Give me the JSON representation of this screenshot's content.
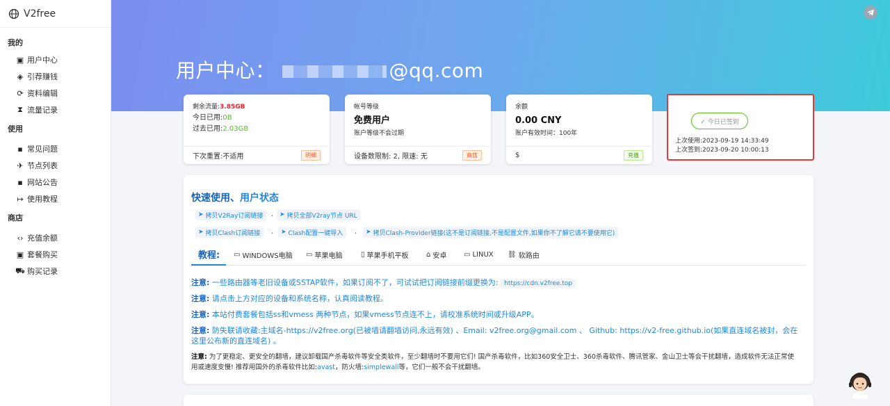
{
  "brand": {
    "name": "V2free",
    "icon": "globe-icon"
  },
  "sidebar": {
    "sections": [
      {
        "title": "我的",
        "items": [
          {
            "label": "用户中心",
            "icon": "wallet-icon"
          },
          {
            "label": "引荐赚钱",
            "icon": "tag-icon"
          },
          {
            "label": "资料编辑",
            "icon": "sync-icon"
          },
          {
            "label": "流量记录",
            "icon": "hourglass-icon"
          }
        ]
      },
      {
        "title": "使用",
        "items": [
          {
            "label": "常见问题",
            "icon": "comment-alert-icon"
          },
          {
            "label": "节点列表",
            "icon": "plane-icon"
          },
          {
            "label": "网站公告",
            "icon": "announcement-icon"
          },
          {
            "label": "使用教程",
            "icon": "login-arrow-icon"
          }
        ]
      },
      {
        "title": "商店",
        "items": [
          {
            "label": "充值余额",
            "icon": "code-icon"
          },
          {
            "label": "套餐购买",
            "icon": "shopping-bag-icon"
          },
          {
            "label": "购买记录",
            "icon": "cart-icon"
          }
        ]
      }
    ]
  },
  "hero": {
    "title_prefix": "用户中心：",
    "email_suffix": "@qq.com"
  },
  "cards": {
    "traffic": {
      "remaining_label": "剩余流量:",
      "remaining_value": "3.85GB",
      "today_label": "今日已用:",
      "today_value": "0B",
      "past_label": "过去已用:",
      "past_value": "2.03GB",
      "reset": "下次重置:不适用",
      "tag": "明细"
    },
    "level": {
      "label": "帐号等级",
      "value": "免费用户",
      "sub": "账户等级不会过期",
      "foot": "设备数限制: 2, 限速: 无",
      "tag": "商店"
    },
    "balance": {
      "label": "余额",
      "value": "0.00 CNY",
      "sub": "账户有效时间：100年",
      "foot": "$",
      "tag": "充值"
    },
    "checkin": {
      "button": "✓ 今日已签到",
      "last_used": "上次使用:2023-09-19 14:33:49",
      "last_checkin": "上次签到:2023-09-20 10:00:13"
    }
  },
  "panel": {
    "title_a": "快速使用、",
    "title_b": "用户状态",
    "chips": [
      "拷贝V2Ray订阅链接",
      "拷贝全部V2ray节点 URL",
      "拷贝Clash订阅链接",
      "Clash配置一键导入",
      "拷贝Clash-Provider链接(这不是订阅链接,不是配置文件,如果你不了解它请不要使用它)"
    ],
    "separator": ".",
    "tabs": {
      "active": "教程:",
      "items": [
        {
          "label": "WINDOWS电脑",
          "icon": "monitor-icon"
        },
        {
          "label": "苹果电脑",
          "icon": "laptop-icon"
        },
        {
          "label": "苹果手机平板",
          "icon": "phone-icon"
        },
        {
          "label": "安卓",
          "icon": "android-icon"
        },
        {
          "label": "LINUX",
          "icon": "linux-icon"
        },
        {
          "label": "软路由",
          "icon": "router-icon"
        }
      ]
    },
    "notes": {
      "n1_label": "注意:",
      "n1_text": "一些路由器等老旧设备或SSTAP软件，如果订阅不了，可试试把订阅链接前缀更换为:",
      "n1_code": "https://cdn.v2free.top",
      "n2_label": "注意:",
      "n2_text": "请点击上方对应的设备和系统名称，认真阅读教程。",
      "n3_label": "注意:",
      "n3_text": "本站付费套餐包括ss和vmess 两种节点，如果vmess节点连不上，请校准系统时间或升级APP。",
      "n4_label": "注意:",
      "n4_text": "防失联请收藏:主域名-https://v2free.org(已被墙请翻墙访问,永远有效) 、Email: v2free.org@gmail.com 、 Github: https://v2-free.github.io(如果直连域名被封，会在这里公布新的直连域名) 。",
      "n5_label": "注意:",
      "n5_text_a": "为了更稳定、更安全的翻墙，建议卸载国产杀毒软件等安全类软件，至少翻墙时不要用它们! 国产杀毒软件，比如360安全卫士、360杀毒软件、腾讯管家、金山卫士等会干扰翻墙，造成软件无法正常使用或速度变慢! 推荐用国外的杀毒软件比如:",
      "n5_link1": "avast",
      "n5_text_b": "，防火墙:",
      "n5_link2": "simplewall",
      "n5_text_c": "等，它们一般不会干扰翻墙。"
    }
  },
  "colors": {
    "accent": "#1e88e5",
    "hero_start": "#7b8ef0",
    "hero_end": "#3ecbdb",
    "alert": "#e53935"
  }
}
